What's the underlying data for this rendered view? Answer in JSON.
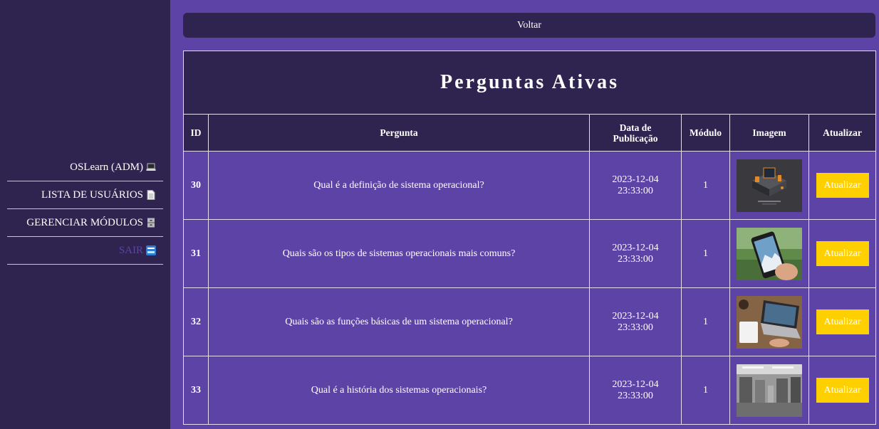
{
  "sidebar": {
    "items": [
      {
        "label": "OSLearn (ADM)",
        "icon": "laptop-icon"
      },
      {
        "label": "LISTA DE USUÁRIOS",
        "icon": "document-icon"
      },
      {
        "label": "GERENCIAR MÓDULOS",
        "icon": "file-cabinet-icon"
      },
      {
        "label": "SAIR",
        "icon": "exit-icon"
      }
    ]
  },
  "main": {
    "back_label": "Voltar",
    "table": {
      "title": "Perguntas Ativas",
      "headers": {
        "id": "ID",
        "question": "Pergunta",
        "date_line1": "Data de",
        "date_line2": "Publicação",
        "module": "Módulo",
        "image": "Imagem",
        "update": "Atualizar"
      },
      "rows": [
        {
          "id": "30",
          "question": "Qual é a definição de sistema operacional?",
          "date": "2023-12-04",
          "time": "23:33:00",
          "module": "1",
          "image": "isometric-computer-illustration",
          "action": "Atualizar"
        },
        {
          "id": "31",
          "question": "Quais são os tipos de sistemas operacionais mais comuns?",
          "date": "2023-12-04",
          "time": "23:33:00",
          "module": "1",
          "image": "smartphone-in-hand-photo",
          "action": "Atualizar"
        },
        {
          "id": "32",
          "question": "Quais são as funções básicas de um sistema operacional?",
          "date": "2023-12-04",
          "time": "23:33:00",
          "module": "1",
          "image": "laptop-on-desk-photo",
          "action": "Atualizar"
        },
        {
          "id": "33",
          "question": "Qual é a história dos sistemas operacionais?",
          "date": "2023-12-04",
          "time": "23:33:00",
          "module": "1",
          "image": "mainframe-room-photo",
          "action": "Atualizar"
        }
      ]
    }
  },
  "colors": {
    "page_bg": "#5e43a6",
    "dark_bg": "#2f2450",
    "button_yellow": "#ffd000"
  }
}
